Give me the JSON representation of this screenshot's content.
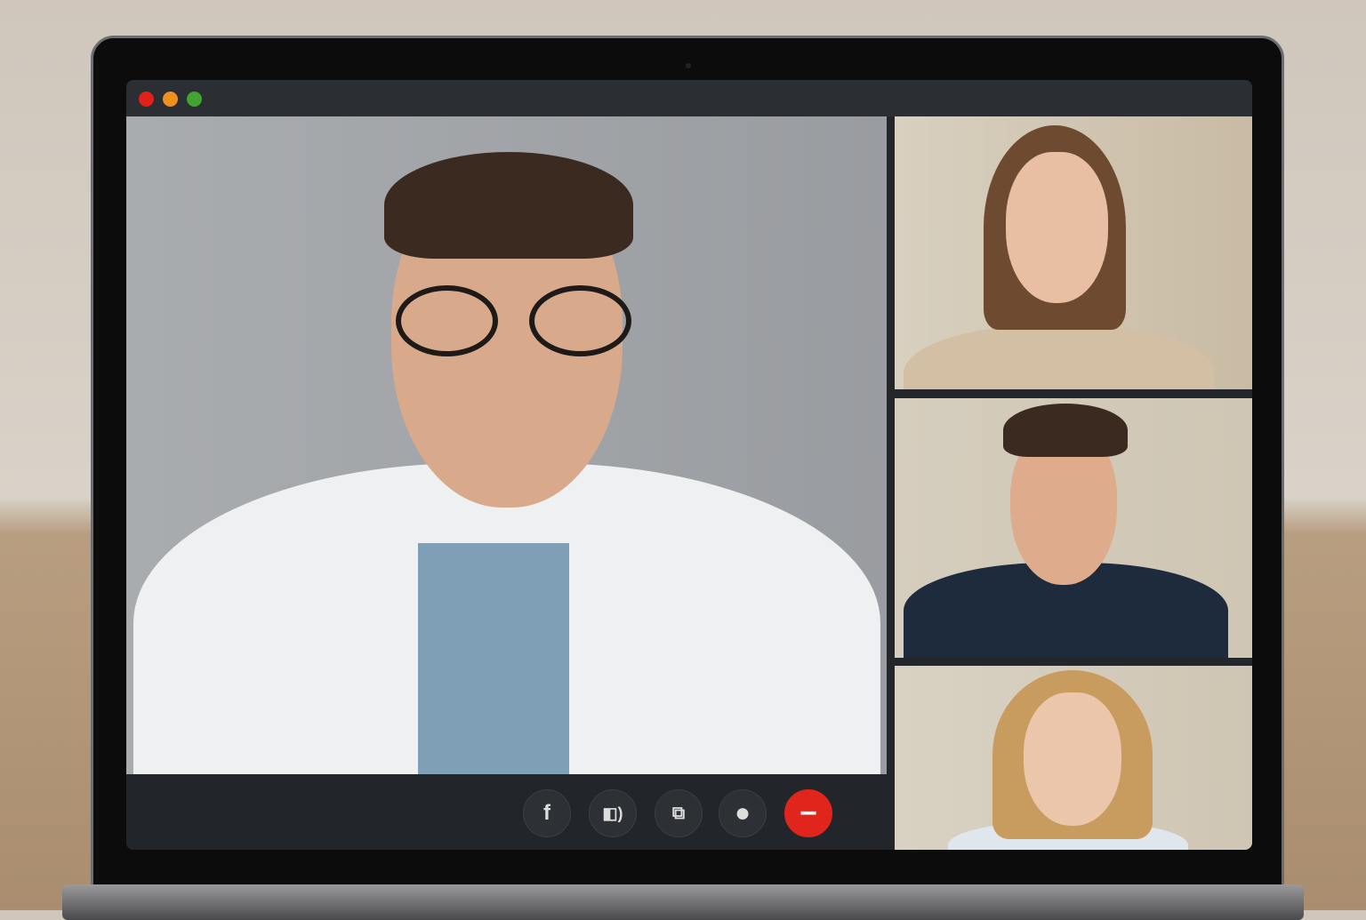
{
  "window": {
    "controls": [
      {
        "name": "close",
        "color": "#e0221b"
      },
      {
        "name": "minimize",
        "color": "#f0901a"
      },
      {
        "name": "maximize",
        "color": "#43a430"
      }
    ]
  },
  "call": {
    "participants": [
      {
        "role": "main-speaker",
        "tile": "main"
      },
      {
        "role": "participant",
        "tile": "side-1"
      },
      {
        "role": "participant",
        "tile": "side-2"
      },
      {
        "role": "participant",
        "tile": "side-3"
      }
    ],
    "controls": [
      {
        "icon": "facebook-icon",
        "glyph": "f"
      },
      {
        "icon": "speaker-icon",
        "glyph": "◧)"
      },
      {
        "icon": "screen-share-icon",
        "glyph": "⧉"
      },
      {
        "icon": "record-icon",
        "glyph": "●"
      },
      {
        "icon": "end-call-icon",
        "glyph": "−",
        "color": "#e0261c"
      }
    ]
  }
}
